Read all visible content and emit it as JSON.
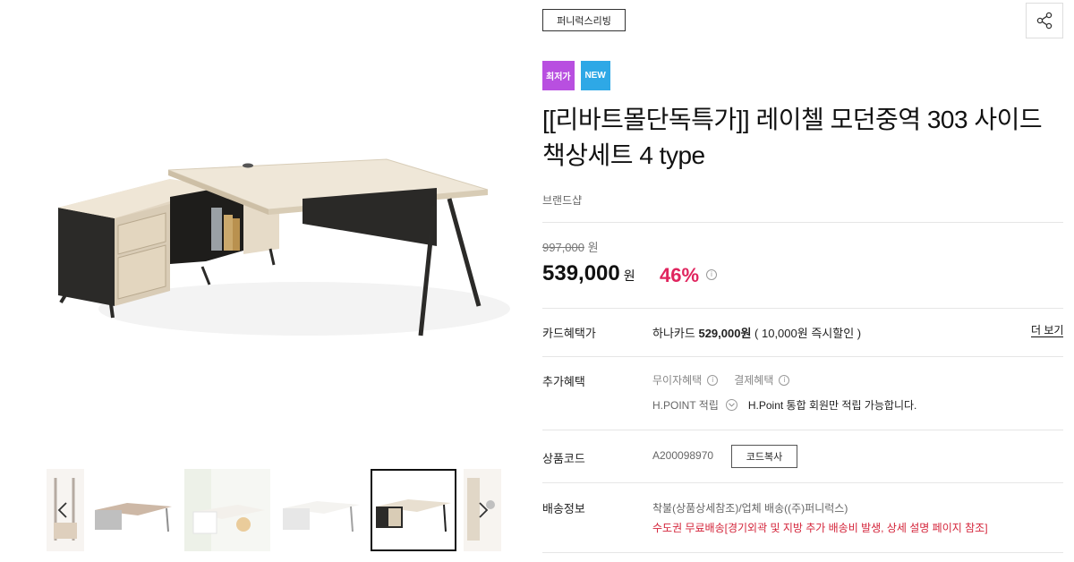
{
  "product": {
    "brand_tag": "퍼니럭스리빙",
    "badges": [
      "최저가",
      "NEW"
    ],
    "title": "[[리바트몰단독특가]] 레이첼 모던중역 303 사이드 책상세트 4 type",
    "brand_name": "브랜드샵"
  },
  "price": {
    "original": "997,000",
    "original_unit": "원",
    "sale": "539,000",
    "sale_unit": "원",
    "discount": "46%"
  },
  "card": {
    "label": "카드혜택가",
    "card_name": "하나카드",
    "card_price": "529,000원",
    "card_note": "( 10,000원 즉시할인 )",
    "more": "더 보기"
  },
  "extra": {
    "label": "추가혜택",
    "benefit1": "무이자혜택",
    "benefit2": "결제혜택",
    "hpoint_label": "H.POINT 적립",
    "hpoint_desc": "H.Point 통합 회원만 적립 가능합니다."
  },
  "code": {
    "label": "상품코드",
    "value": "A200098970",
    "copy_button": "코드복사"
  },
  "shipping": {
    "label": "배송정보",
    "value": "착불(상품상세참조)/업체 배송((주)퍼니럭스)",
    "note": "수도권 무료배송[경기외곽 및 지방 추가 배송비 발생, 상세 설명 페이지 참조]"
  },
  "colors": {
    "discount": "#e0245e",
    "badge_lowest": "#b84fe0",
    "badge_new": "#2ea8e6",
    "shipping_note": "#d4243a"
  },
  "icons": [
    "share-icon",
    "info-icon",
    "chevron-down-icon",
    "chevron-left-icon",
    "chevron-right-icon"
  ]
}
